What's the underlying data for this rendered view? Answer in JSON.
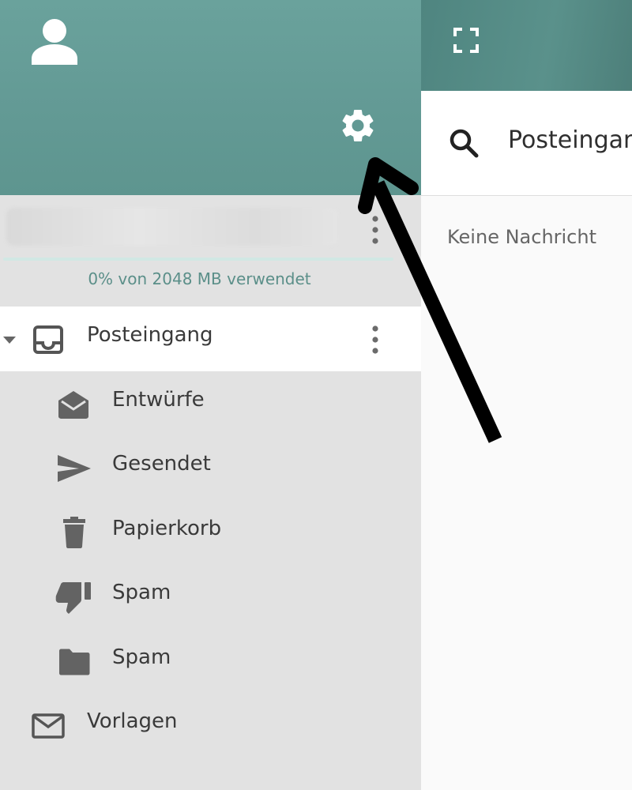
{
  "sidebar": {
    "avatar_icon": "user-icon",
    "settings_icon": "gear-icon",
    "account": {
      "menu_icon": "more-vertical-icon",
      "quota_percent": 0,
      "quota_text": "0% von 2048 MB verwendet"
    },
    "folders": [
      {
        "label": "Posteingang",
        "icon": "inbox-icon",
        "active": true,
        "expanded": true
      },
      {
        "label": "Entwürfe",
        "icon": "envelope-open-icon"
      },
      {
        "label": "Gesendet",
        "icon": "send-icon"
      },
      {
        "label": "Papierkorb",
        "icon": "trash-icon"
      },
      {
        "label": "Spam",
        "icon": "thumbs-down-icon"
      },
      {
        "label": "Spam",
        "icon": "folder-icon"
      },
      {
        "label": "Vorlagen",
        "icon": "envelope-icon"
      }
    ]
  },
  "header": {
    "fullscreen_icon": "fullscreen-icon"
  },
  "search": {
    "icon": "search-icon",
    "title": "Posteingang"
  },
  "message_list": {
    "empty_text": "Keine Nachricht"
  },
  "colors": {
    "header_teal": "#639a95",
    "accent": "#5f9f98",
    "sidebar_bg": "#e2e2e2",
    "annotation_arrow": "#000000"
  }
}
